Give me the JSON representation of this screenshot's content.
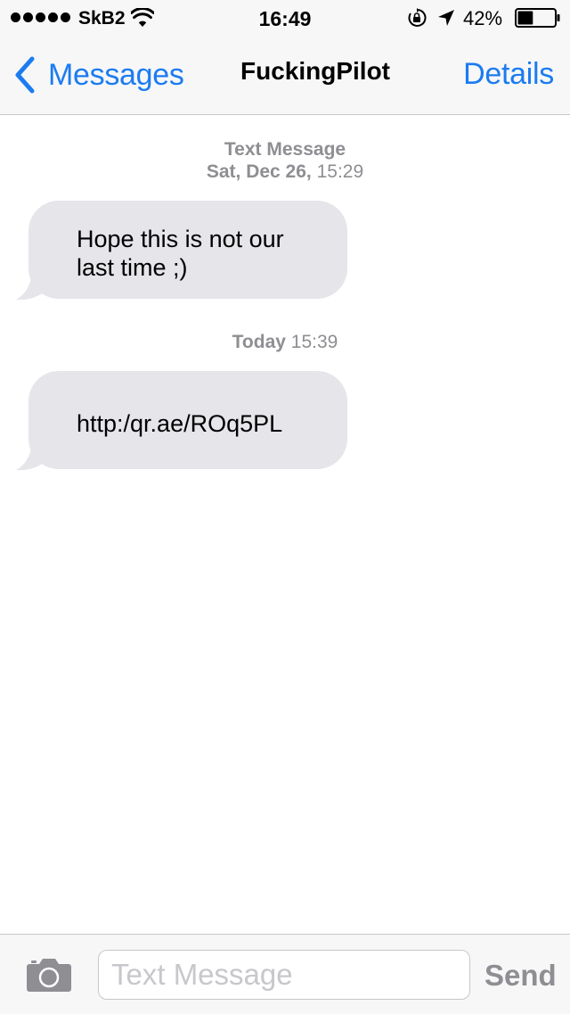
{
  "status_bar": {
    "carrier": "SkB2",
    "time": "16:49",
    "battery_percent": "42%",
    "battery_level": 0.42,
    "signal_bars": 5,
    "icons": [
      "signal-dots-icon",
      "wifi-icon",
      "orientation-lock-icon",
      "location-arrow-icon",
      "battery-icon"
    ]
  },
  "nav": {
    "back_label": "Messages",
    "title": "FuckingPilot",
    "details_label": "Details",
    "accent_color": "#1b7cf0"
  },
  "conversation": {
    "timestamp1": {
      "service": "Text Message",
      "date": "Sat, Dec 26,",
      "time": "15:29"
    },
    "messages": [
      {
        "line1": "Hope this is not our",
        "line2": "last time ;)"
      },
      {
        "text": "http:/qr.ae/ROq5PL"
      }
    ],
    "timestamp2": {
      "day": "Today",
      "time": "15:39"
    },
    "bubble_color": "#e5e5ea"
  },
  "input_bar": {
    "placeholder": "Text Message",
    "value": "",
    "send_label": "Send",
    "camera_icon": "camera-icon"
  }
}
